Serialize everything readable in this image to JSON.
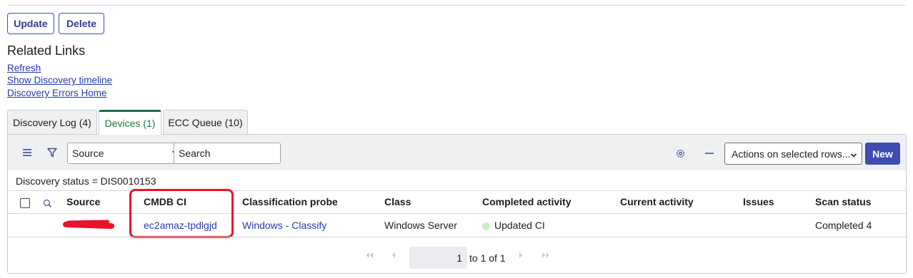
{
  "form_buttons": {
    "update": "Update",
    "delete": "Delete"
  },
  "related": {
    "title": "Related Links",
    "links": [
      "Refresh",
      "Show Discovery timeline",
      "Discovery Errors Home"
    ]
  },
  "tabs": [
    {
      "label": "Discovery Log (4)",
      "active": false
    },
    {
      "label": "Devices (1)",
      "active": true
    },
    {
      "label": "ECC Queue (10)",
      "active": false
    }
  ],
  "toolbar": {
    "search_field": "Source",
    "search_placeholder": "Search",
    "actions_label": "Actions on selected rows...",
    "new_label": "New"
  },
  "breadcrumb": "Discovery status = DIS0010153",
  "table": {
    "columns": [
      "Source",
      "CMDB CI",
      "Classification probe",
      "Class",
      "Completed activity",
      "Current activity",
      "Issues",
      "Scan status"
    ],
    "rows": [
      {
        "source": "",
        "cmdb_ci": "ec2amaz-tpdlgjd",
        "classification_probe": "Windows - Classify",
        "class": "Windows Server",
        "completed_activity": "Updated CI",
        "current_activity": "",
        "issues": "",
        "scan_status": "Completed 4"
      }
    ]
  },
  "pagination": {
    "current": "1",
    "range_text": "to 1 of 1"
  },
  "colors": {
    "accent": "#3f4db0",
    "link": "#2a3aa8",
    "active_tab": "#1e6e44",
    "annotation": "#e8132a",
    "status_dot": "#c7eec9"
  }
}
